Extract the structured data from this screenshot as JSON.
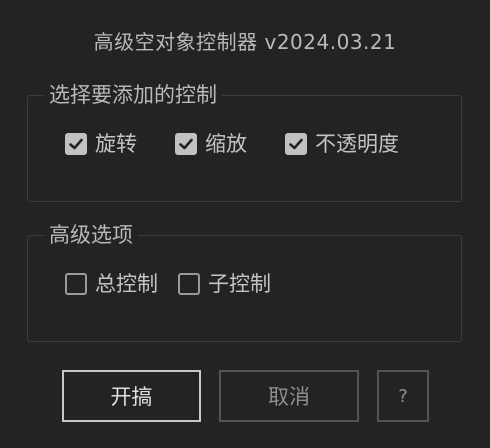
{
  "window": {
    "title": "高级空对象控制器 v2024.03.21"
  },
  "basic_group": {
    "legend": "选择要添加的控制",
    "options": [
      {
        "label": "旋转",
        "checked": true
      },
      {
        "label": "缩放",
        "checked": true
      },
      {
        "label": "不透明度",
        "checked": true
      }
    ]
  },
  "advanced_group": {
    "legend": "高级选项",
    "options": [
      {
        "label": "总控制",
        "checked": false
      },
      {
        "label": "子控制",
        "checked": false
      }
    ]
  },
  "buttons": {
    "ok_label": "开搞",
    "cancel_label": "取消",
    "help_label": "?"
  },
  "colors": {
    "background": "#232323",
    "text": "#c4c4c4",
    "checkbox_checked": "#c2c2c2",
    "ok_border": "#c8c8c8",
    "secondary_border": "#555555"
  }
}
